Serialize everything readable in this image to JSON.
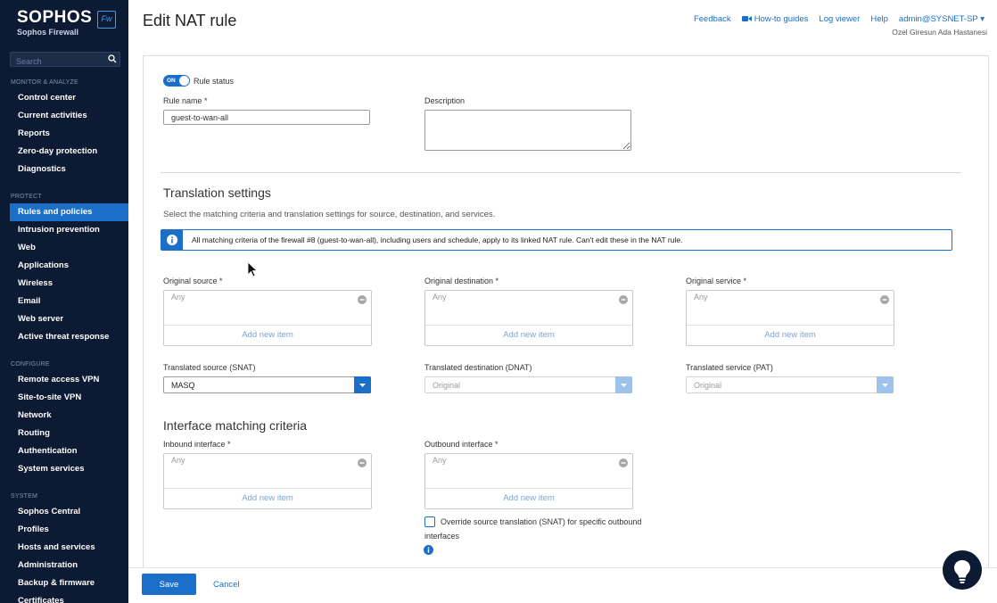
{
  "sidebar": {
    "brand": "SOPHOS",
    "brand_sub": "Sophos Firewall",
    "badge": "Fw",
    "search_placeholder": "Search",
    "sections": [
      {
        "title": "MONITOR & ANALYZE",
        "items": [
          "Control center",
          "Current activities",
          "Reports",
          "Zero-day protection",
          "Diagnostics"
        ]
      },
      {
        "title": "PROTECT",
        "items": [
          "Rules and policies",
          "Intrusion prevention",
          "Web",
          "Applications",
          "Wireless",
          "Email",
          "Web server",
          "Active threat response"
        ]
      },
      {
        "title": "CONFIGURE",
        "items": [
          "Remote access VPN",
          "Site-to-site VPN",
          "Network",
          "Routing",
          "Authentication",
          "System services"
        ]
      },
      {
        "title": "SYSTEM",
        "items": [
          "Sophos Central",
          "Profiles",
          "Hosts and services",
          "Administration",
          "Backup & firmware",
          "Certificates"
        ]
      }
    ],
    "active_item": "Rules and policies"
  },
  "header": {
    "title": "Edit NAT rule",
    "links": {
      "feedback": "Feedback",
      "howto": "How-to guides",
      "logviewer": "Log viewer",
      "help": "Help",
      "user": "admin@SYSNET-SP ▾"
    },
    "org": "Ozel Giresun Ada Hastanesi"
  },
  "form": {
    "toggle_label": "ON",
    "rule_status": "Rule status",
    "rule_name_label": "Rule name *",
    "rule_name_value": "guest-to-wan-all",
    "description_label": "Description"
  },
  "translation": {
    "title": "Translation settings",
    "desc": "Select the matching criteria and translation settings for source, destination, and services.",
    "info": "All matching criteria of the firewall #8 (guest-to-wan-all), including users and schedule, apply to its linked NAT rule. Can't edit these in the NAT rule.",
    "orig_source_label": "Original source *",
    "orig_dest_label": "Original destination *",
    "orig_service_label": "Original service *",
    "any": "Any",
    "add_new_item": "Add new item",
    "snat_label": "Translated source (SNAT)",
    "snat_value": "MASQ",
    "dnat_label": "Translated destination (DNAT)",
    "dnat_value": "Original",
    "pat_label": "Translated service (PAT)",
    "pat_value": "Original"
  },
  "interface": {
    "title": "Interface matching criteria",
    "inbound_label": "Inbound interface *",
    "outbound_label": "Outbound interface *",
    "override_line1": "Override source translation (SNAT) for specific outbound",
    "override_line2": "interfaces"
  },
  "footer": {
    "save": "Save",
    "cancel": "Cancel"
  },
  "colors": {
    "sidebar_bg": "#0d1a33",
    "accent": "#1b6fc9"
  }
}
